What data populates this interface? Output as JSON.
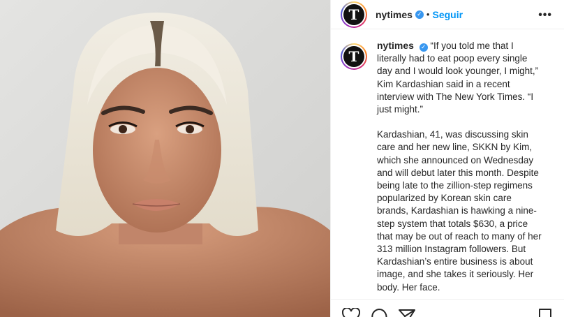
{
  "post": {
    "author": "nytimes",
    "follow_label": "Seguir",
    "more_label": "•••",
    "avatar_letter": "T",
    "verified_mark": "✓",
    "separator": "•"
  },
  "caption": {
    "username": "nytimes",
    "paragraph1": "“If you told me that I literally had to eat poop every single day and I would look younger, I might,” Kim Kardashian said in a recent interview with The New York Times. “I just might.”",
    "paragraph2": "Kardashian, 41, was discussing skin care and her new line, SKKN by Kim, which she announced on Wednesday and will debut later this month. Despite being late to the zillion-step regimens popularized by Korean skin care brands, Kardashian is hawking a nine-step system that totals $630, a price that may be out of reach to many of her 313 million Instagram followers. But Kardashian’s entire business is about image, and she takes it seriously. Her body. Her face."
  },
  "icons": {
    "like": "heart-icon",
    "comment": "comment-icon",
    "share": "share-icon",
    "save": "bookmark-icon",
    "verified": "verified-badge-icon",
    "more": "more-options-icon"
  },
  "colors": {
    "accent": "#0095f6",
    "verified": "#3897f0",
    "text": "#262626",
    "divider": "#efefef"
  }
}
